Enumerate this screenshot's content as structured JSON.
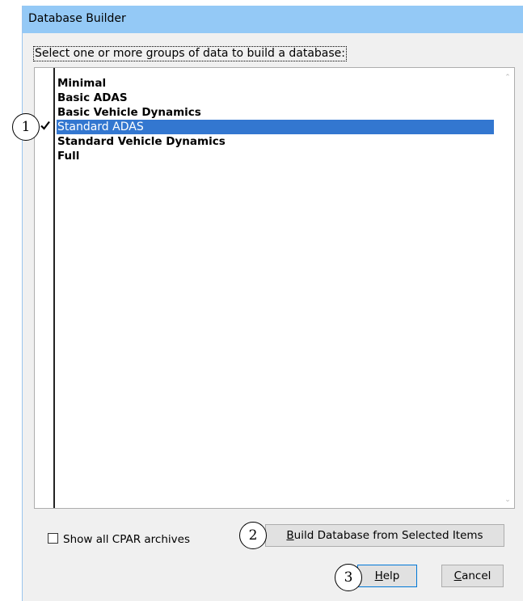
{
  "window": {
    "title": "Database Builder"
  },
  "prompt": "Select one or more groups of data to build a database:",
  "list": {
    "items": [
      {
        "label": "Minimal",
        "selected": false,
        "checked": false
      },
      {
        "label": "Basic ADAS",
        "selected": false,
        "checked": false
      },
      {
        "label": "Basic Vehicle Dynamics",
        "selected": false,
        "checked": false
      },
      {
        "label": "Standard ADAS",
        "selected": true,
        "checked": true
      },
      {
        "label": "Standard Vehicle Dynamics",
        "selected": false,
        "checked": false
      },
      {
        "label": "Full",
        "selected": false,
        "checked": false
      }
    ]
  },
  "options": {
    "show_all_cpar_label": "Show all CPAR archives",
    "show_all_cpar_checked": false
  },
  "buttons": {
    "build": {
      "access_key": "B",
      "rest": "uild Database from Selected Items"
    },
    "help": {
      "access_key": "H",
      "rest": "elp"
    },
    "cancel": {
      "access_key": "C",
      "rest": "ancel"
    }
  },
  "callouts": [
    "1",
    "2",
    "3"
  ],
  "colors": {
    "titlebar": "#94c9f6",
    "selection": "#3377d0",
    "dialog_bg": "#f0f0f0"
  }
}
